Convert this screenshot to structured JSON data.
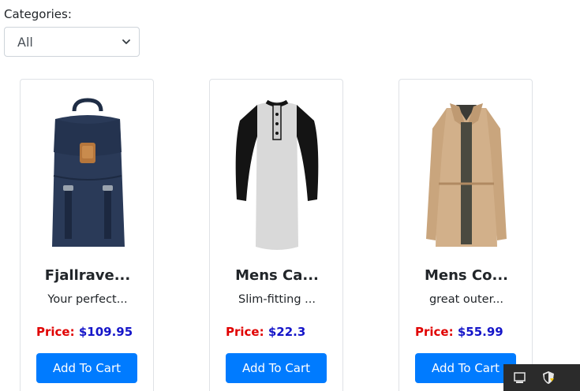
{
  "filter": {
    "label": "Categories:",
    "selected": "All"
  },
  "products": [
    {
      "title": "Fjallrave...",
      "description": "Your perfect...",
      "price_label": "Price:",
      "price": "$109.95",
      "button_label": "Add To Cart",
      "image": "navy-backpack"
    },
    {
      "title": "Mens Ca...",
      "description": "Slim-fitting ...",
      "price_label": "Price:",
      "price": "$22.3",
      "button_label": "Add To Cart",
      "image": "raglan-tshirt"
    },
    {
      "title": "Mens Co...",
      "description": "great outer...",
      "price_label": "Price:",
      "price": "$55.99",
      "button_label": "Add To Cart",
      "image": "beige-jacket"
    }
  ],
  "colors": {
    "button": "#007bff",
    "price_label": "#e00000",
    "price_value": "#1515c9"
  },
  "tray": {
    "icons": [
      "notification-icon",
      "security-shield-icon"
    ]
  }
}
